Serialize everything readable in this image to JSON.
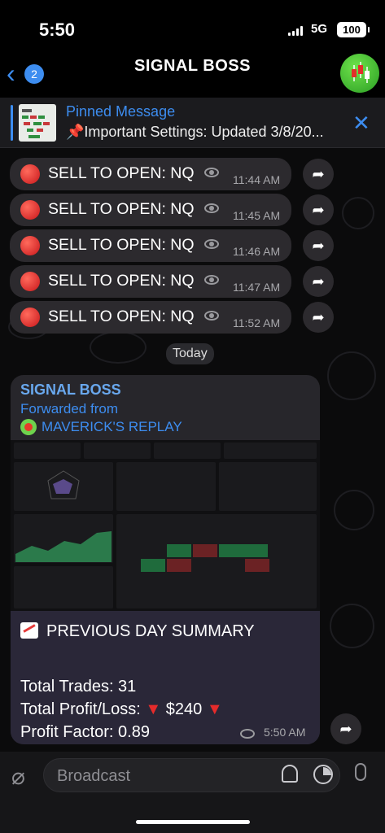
{
  "status_bar": {
    "time": "5:50",
    "network": "5G",
    "battery": "100"
  },
  "header": {
    "title": "SIGNAL BOSS",
    "back_count": "2",
    "back_icon": "chevron-left-icon"
  },
  "pinned": {
    "title": "Pinned Message",
    "text": "📌Important Settings: Updated 3/8/20..."
  },
  "messages": [
    {
      "text": "SELL TO OPEN: NQ",
      "time": "11:44 AM"
    },
    {
      "text": "SELL TO OPEN: NQ",
      "time": "11:45 AM"
    },
    {
      "text": "SELL TO OPEN: NQ",
      "time": "11:46 AM"
    },
    {
      "text": "SELL TO OPEN: NQ",
      "time": "11:47 AM"
    },
    {
      "text": "SELL TO OPEN: NQ",
      "time": "11:52 AM"
    }
  ],
  "date_separator": "Today",
  "forwarded": {
    "sender": "SIGNAL BOSS",
    "forwarded_label": "Forwarded from",
    "origin": "MAVERICK'S REPLAY",
    "heading": "PREVIOUS DAY SUMMARY",
    "trades": "Total Trades: 31",
    "pl_label": "Total Profit/Loss:",
    "pl_value": "$240",
    "profit_factor": "Profit Factor: 0.89",
    "time": "5:50 AM"
  },
  "input": {
    "placeholder": "Broadcast"
  },
  "colors": {
    "accent": "#3d8df0",
    "bubble": "#2c2a2e",
    "red": "#e52b2b"
  }
}
